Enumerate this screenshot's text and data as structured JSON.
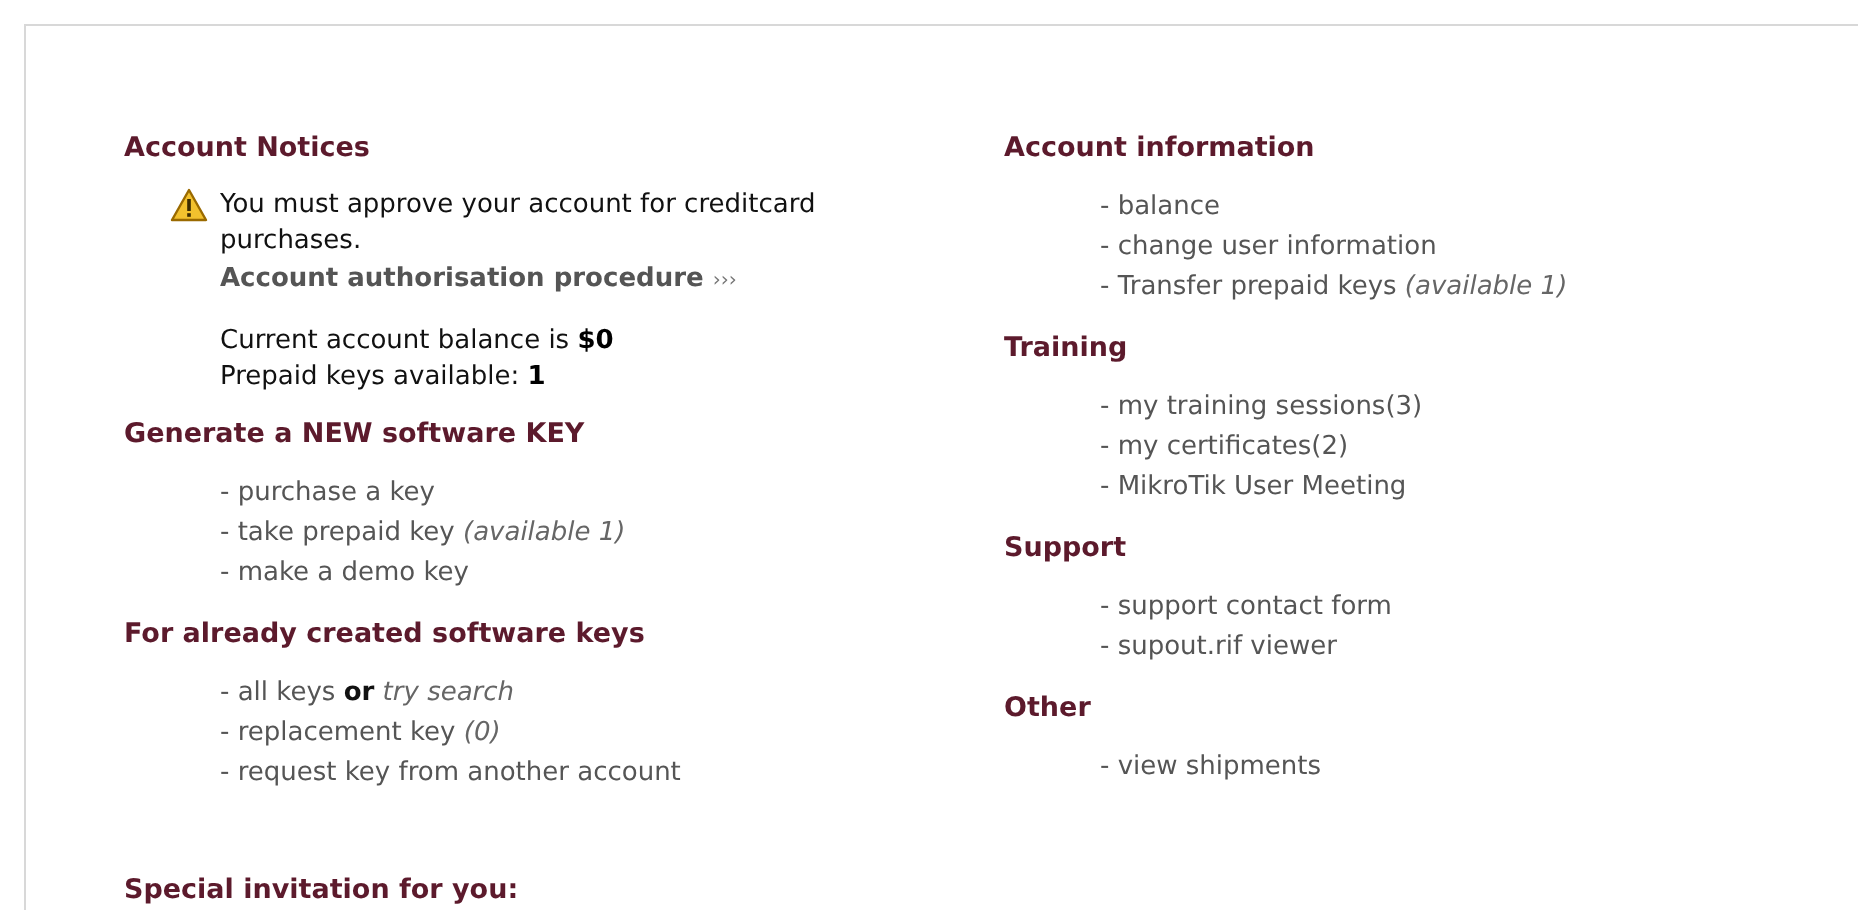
{
  "left": {
    "notices": {
      "heading": "Account Notices",
      "warning": "You must approve your account for creditcard purchases.",
      "link": "Account authorisation procedure",
      "link_arrow": "›››",
      "balance": "Current account balance is **$0**",
      "prepaid": "Prepaid keys available: **1**"
    },
    "sections": [
      {
        "heading": "Generate a NEW software KEY",
        "items": [
          "- purchase a key",
          "- take prepaid key *(available 1)*",
          "- make a demo key"
        ]
      },
      {
        "heading": "For already created software keys",
        "items": [
          "- all keys **or** *try search*",
          "- replacement key *(0)*",
          "- request key from another account"
        ]
      }
    ],
    "footer_heading": "Special invitation for you:"
  },
  "right": {
    "sections": [
      {
        "heading": "Account information",
        "items": [
          "- balance",
          "- change user information",
          "- Transfer prepaid keys *(available 1)*"
        ]
      },
      {
        "heading": "Training",
        "items": [
          "- my training sessions(3)",
          "- my certificates(2)",
          "- MikroTik User Meeting"
        ]
      },
      {
        "heading": "Support",
        "items": [
          "- support contact form",
          "- supout.rif viewer"
        ]
      },
      {
        "heading": "Other",
        "items": [
          "- view shipments"
        ]
      }
    ]
  }
}
